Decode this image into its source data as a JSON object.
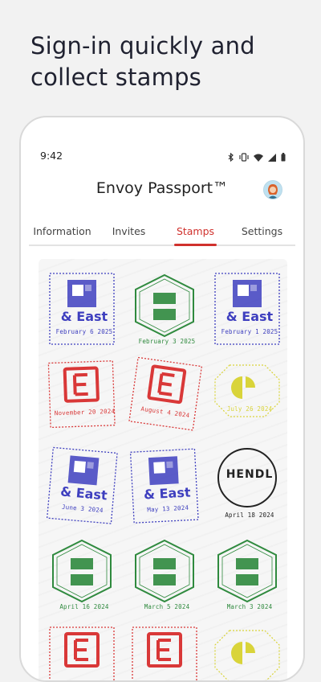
{
  "headline": "Sign-in quickly and collect stamps",
  "status": {
    "time": "9:42"
  },
  "app": {
    "title": "Envoy Passport™"
  },
  "tabs": [
    {
      "label": "Information",
      "active": false
    },
    {
      "label": "Invites",
      "active": false
    },
    {
      "label": "Stamps",
      "active": true
    },
    {
      "label": "Settings",
      "active": false
    }
  ],
  "colors": {
    "accent": "#d0312d",
    "blue": "#3e3fbf",
    "green": "#2f8a3e",
    "red": "#d93838",
    "yellow": "#d9d43a",
    "black": "#222222"
  },
  "stamps": [
    {
      "kind": "east",
      "color": "blue",
      "label": "& East",
      "date": "February 6 2025"
    },
    {
      "kind": "hexagon",
      "color": "green",
      "label": "",
      "date": "February 3 2025"
    },
    {
      "kind": "east",
      "color": "blue",
      "label": "& East",
      "date": "February 1 2025"
    },
    {
      "kind": "e-square",
      "color": "red",
      "label": "",
      "date": "November 20 2024"
    },
    {
      "kind": "e-square",
      "color": "red",
      "label": "",
      "date": "August 4 2024"
    },
    {
      "kind": "yellow-oval",
      "color": "yellow",
      "label": "",
      "date": "July 26 2024"
    },
    {
      "kind": "east",
      "color": "blue",
      "label": "& East",
      "date": "June 3 2024"
    },
    {
      "kind": "east",
      "color": "blue",
      "label": "& East",
      "date": "May 13 2024"
    },
    {
      "kind": "hendl",
      "color": "black",
      "label": "HENDL",
      "date": "April 18 2024"
    },
    {
      "kind": "hexagon",
      "color": "green",
      "label": "",
      "date": "April 16 2024"
    },
    {
      "kind": "hexagon",
      "color": "green",
      "label": "",
      "date": "March 5 2024"
    },
    {
      "kind": "hexagon",
      "color": "green",
      "label": "",
      "date": "March 3 2024"
    },
    {
      "kind": "e-square",
      "color": "red",
      "label": "",
      "date": ""
    },
    {
      "kind": "e-square",
      "color": "red",
      "label": "",
      "date": ""
    },
    {
      "kind": "yellow-oval",
      "color": "yellow",
      "label": "",
      "date": ""
    }
  ]
}
